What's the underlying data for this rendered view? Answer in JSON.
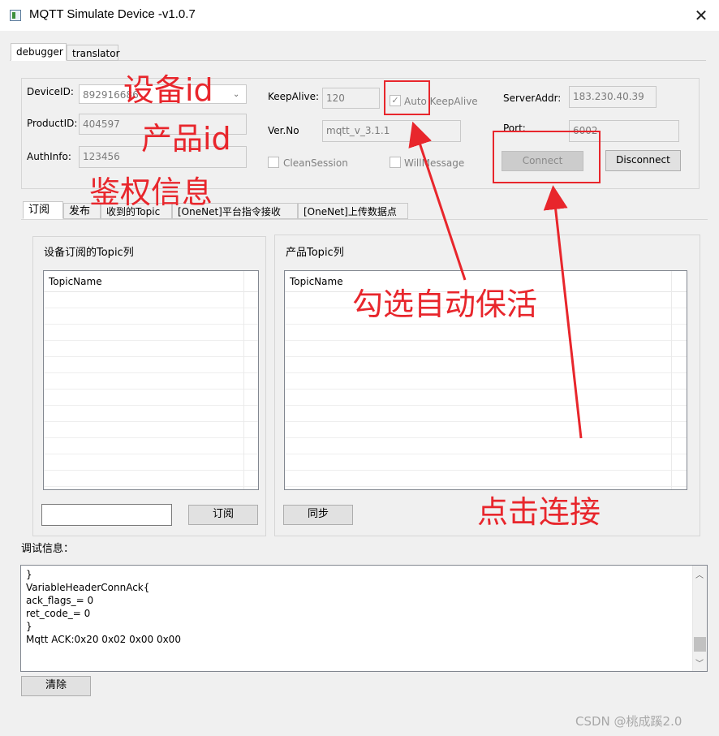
{
  "window": {
    "title": "MQTT Simulate Device  -v1.0.7",
    "close_glyph": "✕"
  },
  "main_tabs": [
    "debugger",
    "translator"
  ],
  "conn": {
    "device_id_label": "DeviceID:",
    "device_id_value": "892916686",
    "product_id_label": "ProductID:",
    "product_id_value": "404597",
    "auth_label": "AuthInfo:",
    "auth_value": "123456",
    "keepalive_label": "KeepAlive:",
    "keepalive_value": "120",
    "auto_keepalive_label": "Auto KeepAlive",
    "auto_keepalive_checked": true,
    "ver_label": "Ver.No",
    "ver_value": "mqtt_v_3.1.1",
    "clean_session_label": "CleanSession",
    "will_message_label": "WillMessage",
    "server_label": "ServerAddr:",
    "server_value": "183.230.40.39",
    "port_label": "Port:",
    "port_value": "6002",
    "connect_label": "Connect",
    "disconnect_label": "Disconnect"
  },
  "sub_tabs": [
    "订阅",
    "发布",
    "收到的Topic",
    "[OneNet]平台指令接收",
    "[OneNet]上传数据点"
  ],
  "left_panel": {
    "title": "设备订阅的Topic列",
    "column": "TopicName",
    "subscribe_button": "订阅",
    "input_value": ""
  },
  "right_panel": {
    "title": "产品Topic列",
    "column": "TopicName",
    "sync_button": "同步"
  },
  "debug": {
    "label": "调试信息：",
    "lines": [
      "}",
      "VariableHeaderConnAck{",
      "ack_flags_= 0",
      "ret_code_= 0",
      "}",
      "Mqtt ACK:0x20 0x02 0x00 0x00"
    ],
    "clear_button": "清除"
  },
  "annotations": {
    "device_id": "设备id",
    "product_id": "产品id",
    "auth": "鉴权信息",
    "auto_keepalive": "勾选自动保活",
    "connect": "点击连接",
    "color": "#e8262c"
  },
  "watermark": "CSDN @桃成蹊2.0"
}
